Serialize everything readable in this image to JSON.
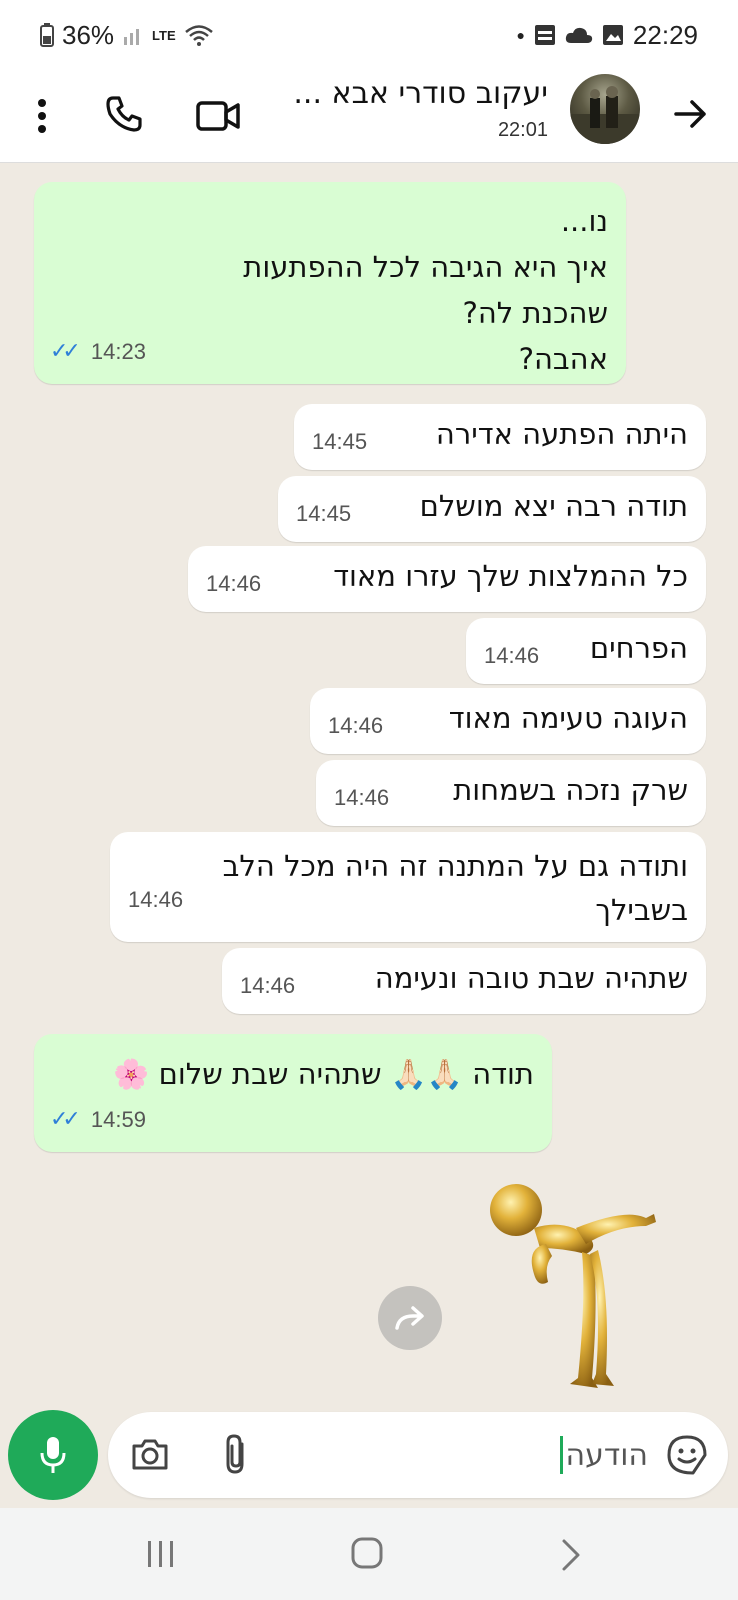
{
  "status_bar": {
    "battery": "36%",
    "time": "22:29",
    "network": "LTE"
  },
  "header": {
    "contact_name": "יעקוב סודרי אבא ...",
    "subtitle": "22:01"
  },
  "messages": [
    {
      "direction": "out",
      "text": "נו...\nאיך היא הגיבה לכל ההפתעות שהכנת לה?\nאהבה?",
      "time": "14:23",
      "read": true
    },
    {
      "direction": "in",
      "text": "היתה הפתעה אדירה",
      "time": "14:45"
    },
    {
      "direction": "in",
      "text": "תודה רבה יצא מושלם",
      "time": "14:45"
    },
    {
      "direction": "in",
      "text": "כל ההמלצות שלך עזרו מאוד",
      "time": "14:46"
    },
    {
      "direction": "in",
      "text": "הפרחים",
      "time": "14:46"
    },
    {
      "direction": "in",
      "text": "העוגה טעימה מאוד",
      "time": "14:46"
    },
    {
      "direction": "in",
      "text": "שרק נזכה בשמחות",
      "time": "14:46"
    },
    {
      "direction": "in",
      "text": "ותודה גם על המתנה זה היה מכל הלב בשבילך",
      "time": "14:46"
    },
    {
      "direction": "in",
      "text": "שתהיה שבת טובה ונעימה",
      "time": "14:46"
    },
    {
      "direction": "out",
      "text": "תודה 🙏🏻🙏🏻 שתהיה שבת שלום 🌸",
      "time": "14:59",
      "read": true
    }
  ],
  "composer": {
    "text": "הודעה"
  },
  "colors": {
    "chat_bg": "#efeae2",
    "outgoing_bubble": "#d9fdd3",
    "incoming_bubble": "#ffffff",
    "mic_button": "#1faa59",
    "read_ticks": "#2f7fd8"
  },
  "icons": [
    "back-arrow-icon",
    "video-call-icon",
    "phone-icon",
    "more-options-icon",
    "mic-icon",
    "camera-icon",
    "attach-icon",
    "sticker-icon",
    "forward-icon"
  ]
}
